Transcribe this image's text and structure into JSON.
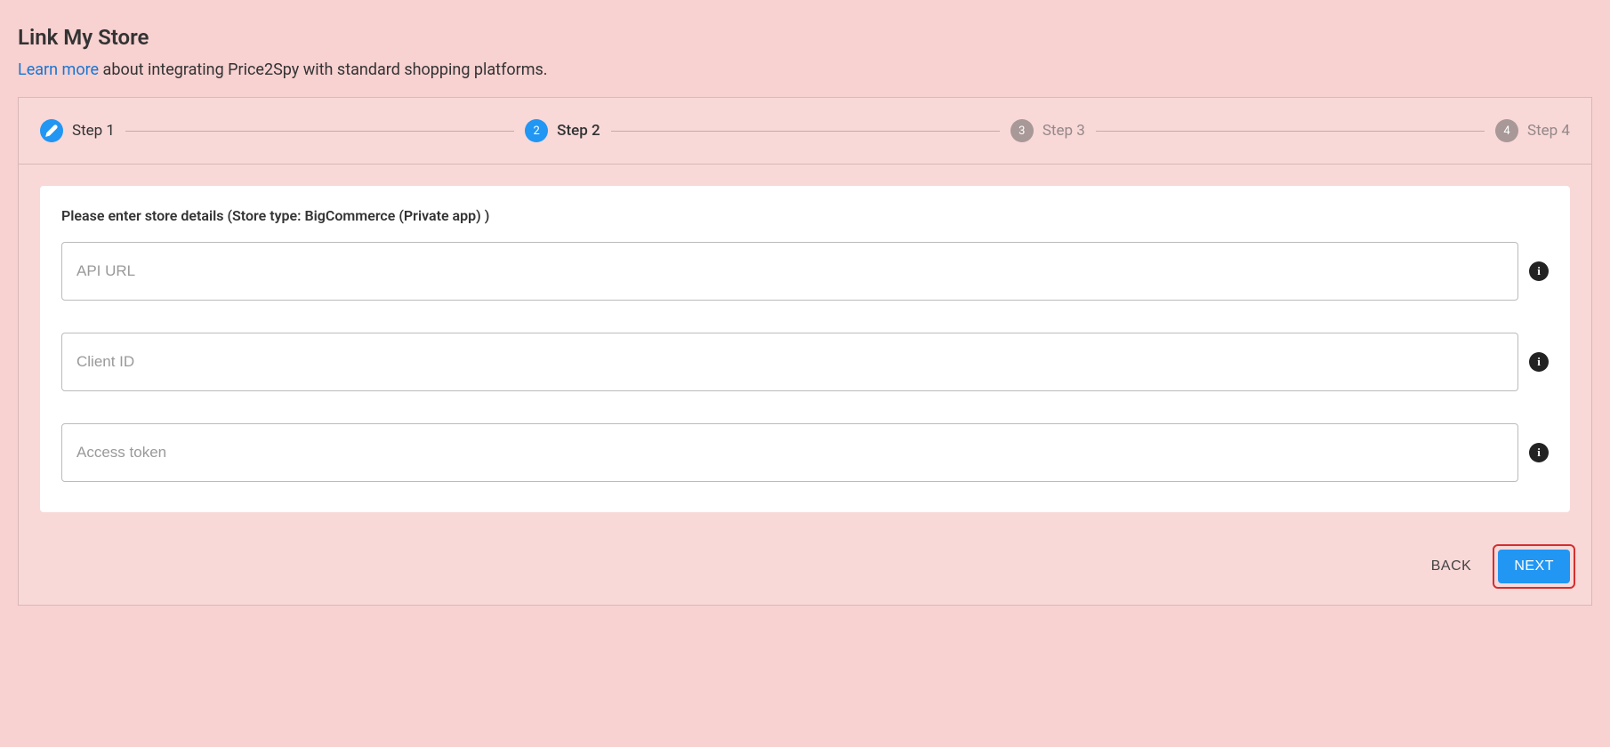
{
  "page": {
    "title": "Link My Store",
    "learn_more_text": "Learn more",
    "subtitle_rest": " about integrating Price2Spy with standard shopping platforms."
  },
  "stepper": {
    "steps": [
      {
        "number": "1",
        "label": "Step 1",
        "state": "completed"
      },
      {
        "number": "2",
        "label": "Step 2",
        "state": "active"
      },
      {
        "number": "3",
        "label": "Step 3",
        "state": "inactive"
      },
      {
        "number": "4",
        "label": "Step 4",
        "state": "inactive"
      }
    ]
  },
  "form": {
    "heading": "Please enter store details (Store type: BigCommerce (Private app) )",
    "fields": {
      "api_url": {
        "placeholder": "API URL",
        "value": ""
      },
      "client_id": {
        "placeholder": "Client ID",
        "value": ""
      },
      "access_token": {
        "placeholder": "Access token",
        "value": ""
      }
    }
  },
  "buttons": {
    "back": "Back",
    "next": "Next"
  },
  "icons": {
    "info": "i"
  },
  "colors": {
    "background": "#f8d1d1",
    "accent": "#2196f3",
    "link": "#1976d2",
    "highlight_border": "#d32f2f"
  }
}
